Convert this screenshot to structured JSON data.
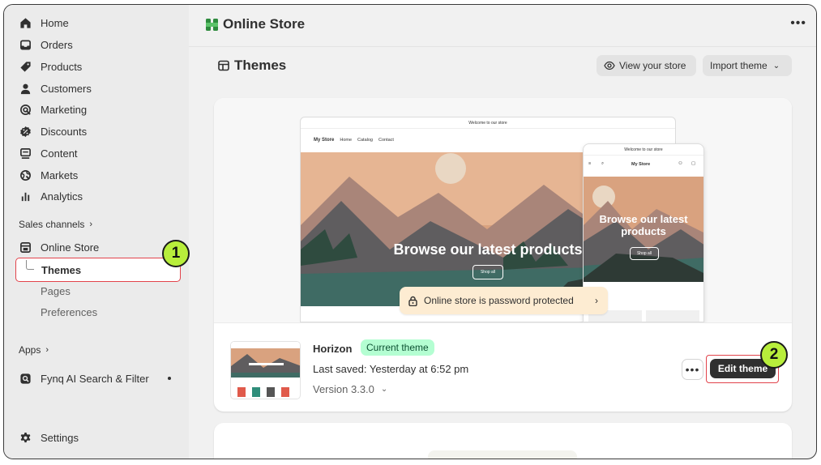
{
  "sidebar": {
    "items": [
      {
        "label": "Home",
        "icon": "home-icon"
      },
      {
        "label": "Orders",
        "icon": "inbox-icon"
      },
      {
        "label": "Products",
        "icon": "tag-icon"
      },
      {
        "label": "Customers",
        "icon": "person-icon"
      },
      {
        "label": "Marketing",
        "icon": "target-icon"
      },
      {
        "label": "Discounts",
        "icon": "discount-icon"
      },
      {
        "label": "Content",
        "icon": "content-icon"
      },
      {
        "label": "Markets",
        "icon": "globe-icon"
      },
      {
        "label": "Analytics",
        "icon": "bar-chart-icon"
      }
    ],
    "sales_channels_label": "Sales channels",
    "online_store_label": "Online Store",
    "sub_items": {
      "themes": "Themes",
      "pages": "Pages",
      "preferences": "Preferences"
    },
    "apps_label": "Apps",
    "app_item": "Fynq AI Search & Filter",
    "settings_label": "Settings"
  },
  "callouts": {
    "one": "1",
    "two": "2"
  },
  "topbar": {
    "title": "Online Store"
  },
  "page": {
    "title": "Themes",
    "view_store": "View your store",
    "import_theme": "Import theme"
  },
  "preview": {
    "announcement": "Welcome to our store",
    "brand": "My Store",
    "nav_links": [
      "Home",
      "Catalog",
      "Contact"
    ],
    "hero_desktop": "Browse our latest products",
    "hero_mobile": "Browse our latest products",
    "shop_all": "Shop all",
    "mobile_section": "ucts",
    "password_banner": "Online store is password protected"
  },
  "theme": {
    "name": "Horizon",
    "badge": "Current theme",
    "last_saved": "Last saved: Yesterday at 6:52 pm",
    "version": "Version 3.3.0",
    "edit_button": "Edit theme"
  },
  "colors": {
    "accent": "#303030",
    "badge_bg": "#b4fed2",
    "callout": "#b8ee3b",
    "highlight": "#e2434b",
    "banner": "#fdecd2"
  }
}
